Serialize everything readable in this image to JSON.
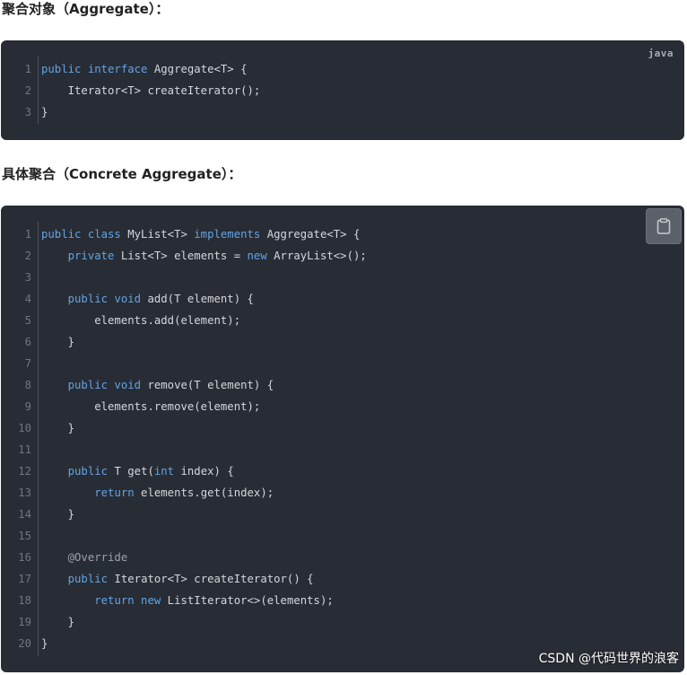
{
  "headings": {
    "aggregate": "聚合对象（Aggregate）：",
    "concrete": "具体聚合（Concrete Aggregate）："
  },
  "block1": {
    "language": "java",
    "lines": [
      {
        "n": "1",
        "tokens": [
          {
            "t": "public interface",
            "c": "kw"
          },
          {
            "t": " Aggregate<T> {",
            "c": "pl"
          }
        ]
      },
      {
        "n": "2",
        "tokens": [
          {
            "t": "    Iterator<T> createIterator();",
            "c": "pl"
          }
        ]
      },
      {
        "n": "3",
        "tokens": [
          {
            "t": "}",
            "c": "pl"
          }
        ]
      }
    ]
  },
  "block2": {
    "copy_icon": "clipboard-icon",
    "lines": [
      {
        "n": "1",
        "tokens": [
          {
            "t": "public class",
            "c": "kw"
          },
          {
            "t": " MyList<T> ",
            "c": "pl"
          },
          {
            "t": "implements",
            "c": "kw"
          },
          {
            "t": " Aggregate<T> {",
            "c": "pl"
          }
        ]
      },
      {
        "n": "2",
        "tokens": [
          {
            "t": "    ",
            "c": "pl"
          },
          {
            "t": "private",
            "c": "kw"
          },
          {
            "t": " List<T> elements = ",
            "c": "pl"
          },
          {
            "t": "new",
            "c": "kw"
          },
          {
            "t": " ArrayList<>();",
            "c": "pl"
          }
        ]
      },
      {
        "n": "3",
        "tokens": []
      },
      {
        "n": "4",
        "tokens": [
          {
            "t": "    ",
            "c": "pl"
          },
          {
            "t": "public void",
            "c": "kw"
          },
          {
            "t": " add(T element) {",
            "c": "pl"
          }
        ]
      },
      {
        "n": "5",
        "tokens": [
          {
            "t": "        elements.add(element);",
            "c": "pl"
          }
        ]
      },
      {
        "n": "6",
        "tokens": [
          {
            "t": "    }",
            "c": "pl"
          }
        ]
      },
      {
        "n": "7",
        "tokens": []
      },
      {
        "n": "8",
        "tokens": [
          {
            "t": "    ",
            "c": "pl"
          },
          {
            "t": "public void",
            "c": "kw"
          },
          {
            "t": " remove(T element) {",
            "c": "pl"
          }
        ]
      },
      {
        "n": "9",
        "tokens": [
          {
            "t": "        elements.remove(element);",
            "c": "pl"
          }
        ]
      },
      {
        "n": "10",
        "tokens": [
          {
            "t": "    }",
            "c": "pl"
          }
        ]
      },
      {
        "n": "11",
        "tokens": []
      },
      {
        "n": "12",
        "tokens": [
          {
            "t": "    ",
            "c": "pl"
          },
          {
            "t": "public",
            "c": "kw"
          },
          {
            "t": " T get(",
            "c": "pl"
          },
          {
            "t": "int",
            "c": "kw"
          },
          {
            "t": " index) {",
            "c": "pl"
          }
        ]
      },
      {
        "n": "13",
        "tokens": [
          {
            "t": "        ",
            "c": "pl"
          },
          {
            "t": "return",
            "c": "kw"
          },
          {
            "t": " elements.get(index);",
            "c": "pl"
          }
        ]
      },
      {
        "n": "14",
        "tokens": [
          {
            "t": "    }",
            "c": "pl"
          }
        ]
      },
      {
        "n": "15",
        "tokens": []
      },
      {
        "n": "16",
        "tokens": [
          {
            "t": "    @Override",
            "c": "an"
          }
        ]
      },
      {
        "n": "17",
        "tokens": [
          {
            "t": "    ",
            "c": "pl"
          },
          {
            "t": "public",
            "c": "kw"
          },
          {
            "t": " Iterator<T> createIterator() {",
            "c": "pl"
          }
        ]
      },
      {
        "n": "18",
        "tokens": [
          {
            "t": "        ",
            "c": "pl"
          },
          {
            "t": "return new",
            "c": "kw"
          },
          {
            "t": " ListIterator<>(elements);",
            "c": "pl"
          }
        ]
      },
      {
        "n": "19",
        "tokens": [
          {
            "t": "    }",
            "c": "pl"
          }
        ]
      },
      {
        "n": "20",
        "tokens": [
          {
            "t": "}",
            "c": "pl"
          }
        ]
      }
    ]
  },
  "watermark": "CSDN @代码世界的浪客",
  "colors": {
    "code_bg": "#282c34",
    "keyword": "#61a4e6",
    "plain": "#d4d7dd",
    "line_number": "#6e7681"
  }
}
